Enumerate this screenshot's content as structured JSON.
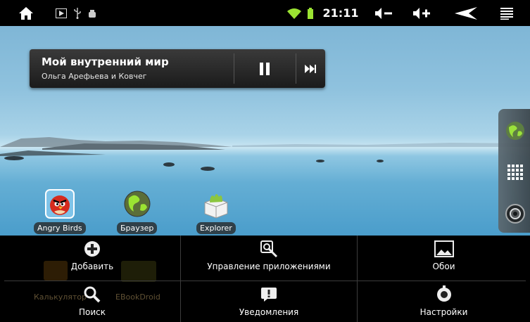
{
  "status_bar": {
    "time": "21:11",
    "icons": [
      "home-icon",
      "media-play-icon",
      "usb-icon",
      "debug-icon",
      "wifi-icon",
      "battery-icon",
      "volume-down-icon",
      "volume-up-icon",
      "back-icon",
      "menu-icon"
    ],
    "accent_color": "#9be332"
  },
  "music_widget": {
    "title": "Мой внутренний мир",
    "artist": "Ольга Арефьева и Ковчег",
    "controls": [
      "pause-icon",
      "next-track-icon"
    ]
  },
  "desktop": {
    "apps": [
      {
        "label": "Angry Birds",
        "icon": "angry-birds-icon"
      },
      {
        "label": "Браузер",
        "icon": "browser-globe-icon"
      },
      {
        "label": "Explorer",
        "icon": "explorer-folder-icon"
      }
    ],
    "dock": [
      "browser-globe-icon",
      "apps-grid-icon",
      "camera-icon"
    ]
  },
  "options_menu": {
    "items": [
      {
        "label": "Добавить",
        "icon": "add-icon"
      },
      {
        "label": "Управление приложениями",
        "icon": "manage-apps-icon"
      },
      {
        "label": "Обои",
        "icon": "wallpaper-icon"
      },
      {
        "label": "Поиск",
        "icon": "search-icon"
      },
      {
        "label": "Уведомления",
        "icon": "notifications-icon"
      },
      {
        "label": "Настройки",
        "icon": "settings-icon"
      }
    ],
    "ghost_labels": [
      "Калькулятор",
      "EBookDroid"
    ]
  }
}
